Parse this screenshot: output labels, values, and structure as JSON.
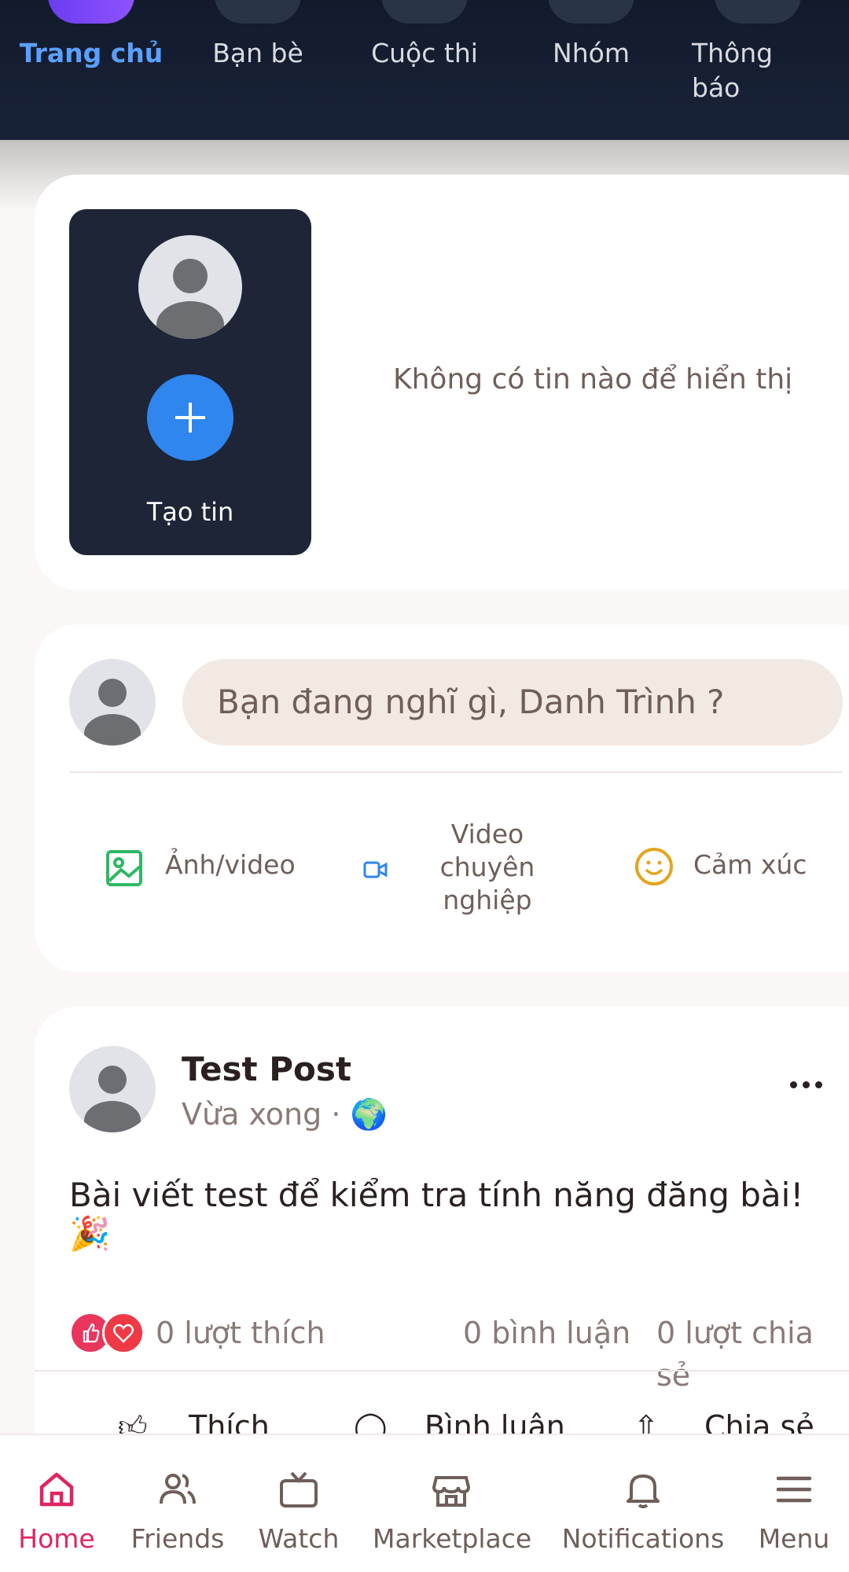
{
  "top_nav": {
    "items": [
      {
        "label": "Trang chủ",
        "active": true
      },
      {
        "label": "Bạn bè"
      },
      {
        "label": "Cuộc thi"
      },
      {
        "label": "Nhóm"
      },
      {
        "label": "Thông báo"
      }
    ]
  },
  "stories": {
    "create_label": "Tạo tin",
    "empty_text": "Không có tin nào để hiển thị"
  },
  "composer": {
    "placeholder": "Bạn đang nghĩ gì, Danh Trình ?",
    "actions": [
      {
        "label": "Ảnh/video",
        "icon": "image-icon"
      },
      {
        "label": "Video chuyên nghiệp",
        "icon": "video-camera-icon"
      },
      {
        "label": "Cảm xúc",
        "icon": "smiley-icon"
      }
    ]
  },
  "post": {
    "author": "Test Post",
    "time": "Vừa xong",
    "separator": "·",
    "privacy_icon": "🌍",
    "text": "Bài viết test để kiểm tra tính năng đăng bài! 🎉",
    "likes": "0 lượt thích",
    "comments": "0 bình luận",
    "shares": "0 lượt chia sẻ",
    "actions": {
      "like": "Thích",
      "comment": "Bình luận",
      "share": "Chia sẻ"
    }
  },
  "bottom_nav": {
    "items": [
      {
        "label": "Home",
        "icon": "home-icon",
        "active": true
      },
      {
        "label": "Friends",
        "icon": "friends-icon"
      },
      {
        "label": "Watch",
        "icon": "tv-icon"
      },
      {
        "label": "Marketplace",
        "icon": "store-icon"
      },
      {
        "label": "Notifications",
        "icon": "bell-icon"
      },
      {
        "label": "Menu",
        "icon": "hamburger-icon"
      }
    ]
  },
  "colors": {
    "accent_active_top": "#5aa0ff",
    "accent_active_bottom": "#e0245e",
    "nav_bg": "#121a2c"
  }
}
